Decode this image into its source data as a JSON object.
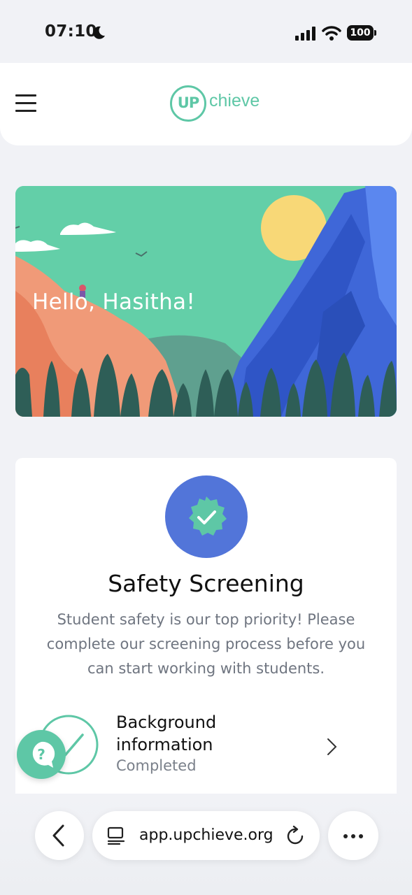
{
  "status_bar": {
    "time": "07:10",
    "battery": "100",
    "icons": [
      "moon-icon",
      "signal-icon",
      "wifi-icon",
      "battery-icon"
    ]
  },
  "header": {
    "menu_icon": "hamburger-menu-icon",
    "logo_mark": "UP",
    "logo_text": "chieve",
    "brand_color": "#5ec7a6"
  },
  "hero": {
    "greeting": "Hello, Hasitha!"
  },
  "screening_card": {
    "badge_icon": "verified-check-badge-icon",
    "badge_color": "#5275d9",
    "title": "Safety Screening",
    "description": "Student safety is our top priority! Please complete our screening process before you can start working with students.",
    "steps": [
      {
        "label": "Background information",
        "status": "Completed",
        "icon": "check-ring-icon"
      }
    ]
  },
  "help_button": {
    "icon": "question-bubble-icon"
  },
  "browser": {
    "url": "app.upchieve.org",
    "back_icon": "chevron-left-icon",
    "tabs_icon": "tab-list-icon",
    "reload_icon": "reload-icon",
    "more_icon": "more-dots-icon"
  }
}
